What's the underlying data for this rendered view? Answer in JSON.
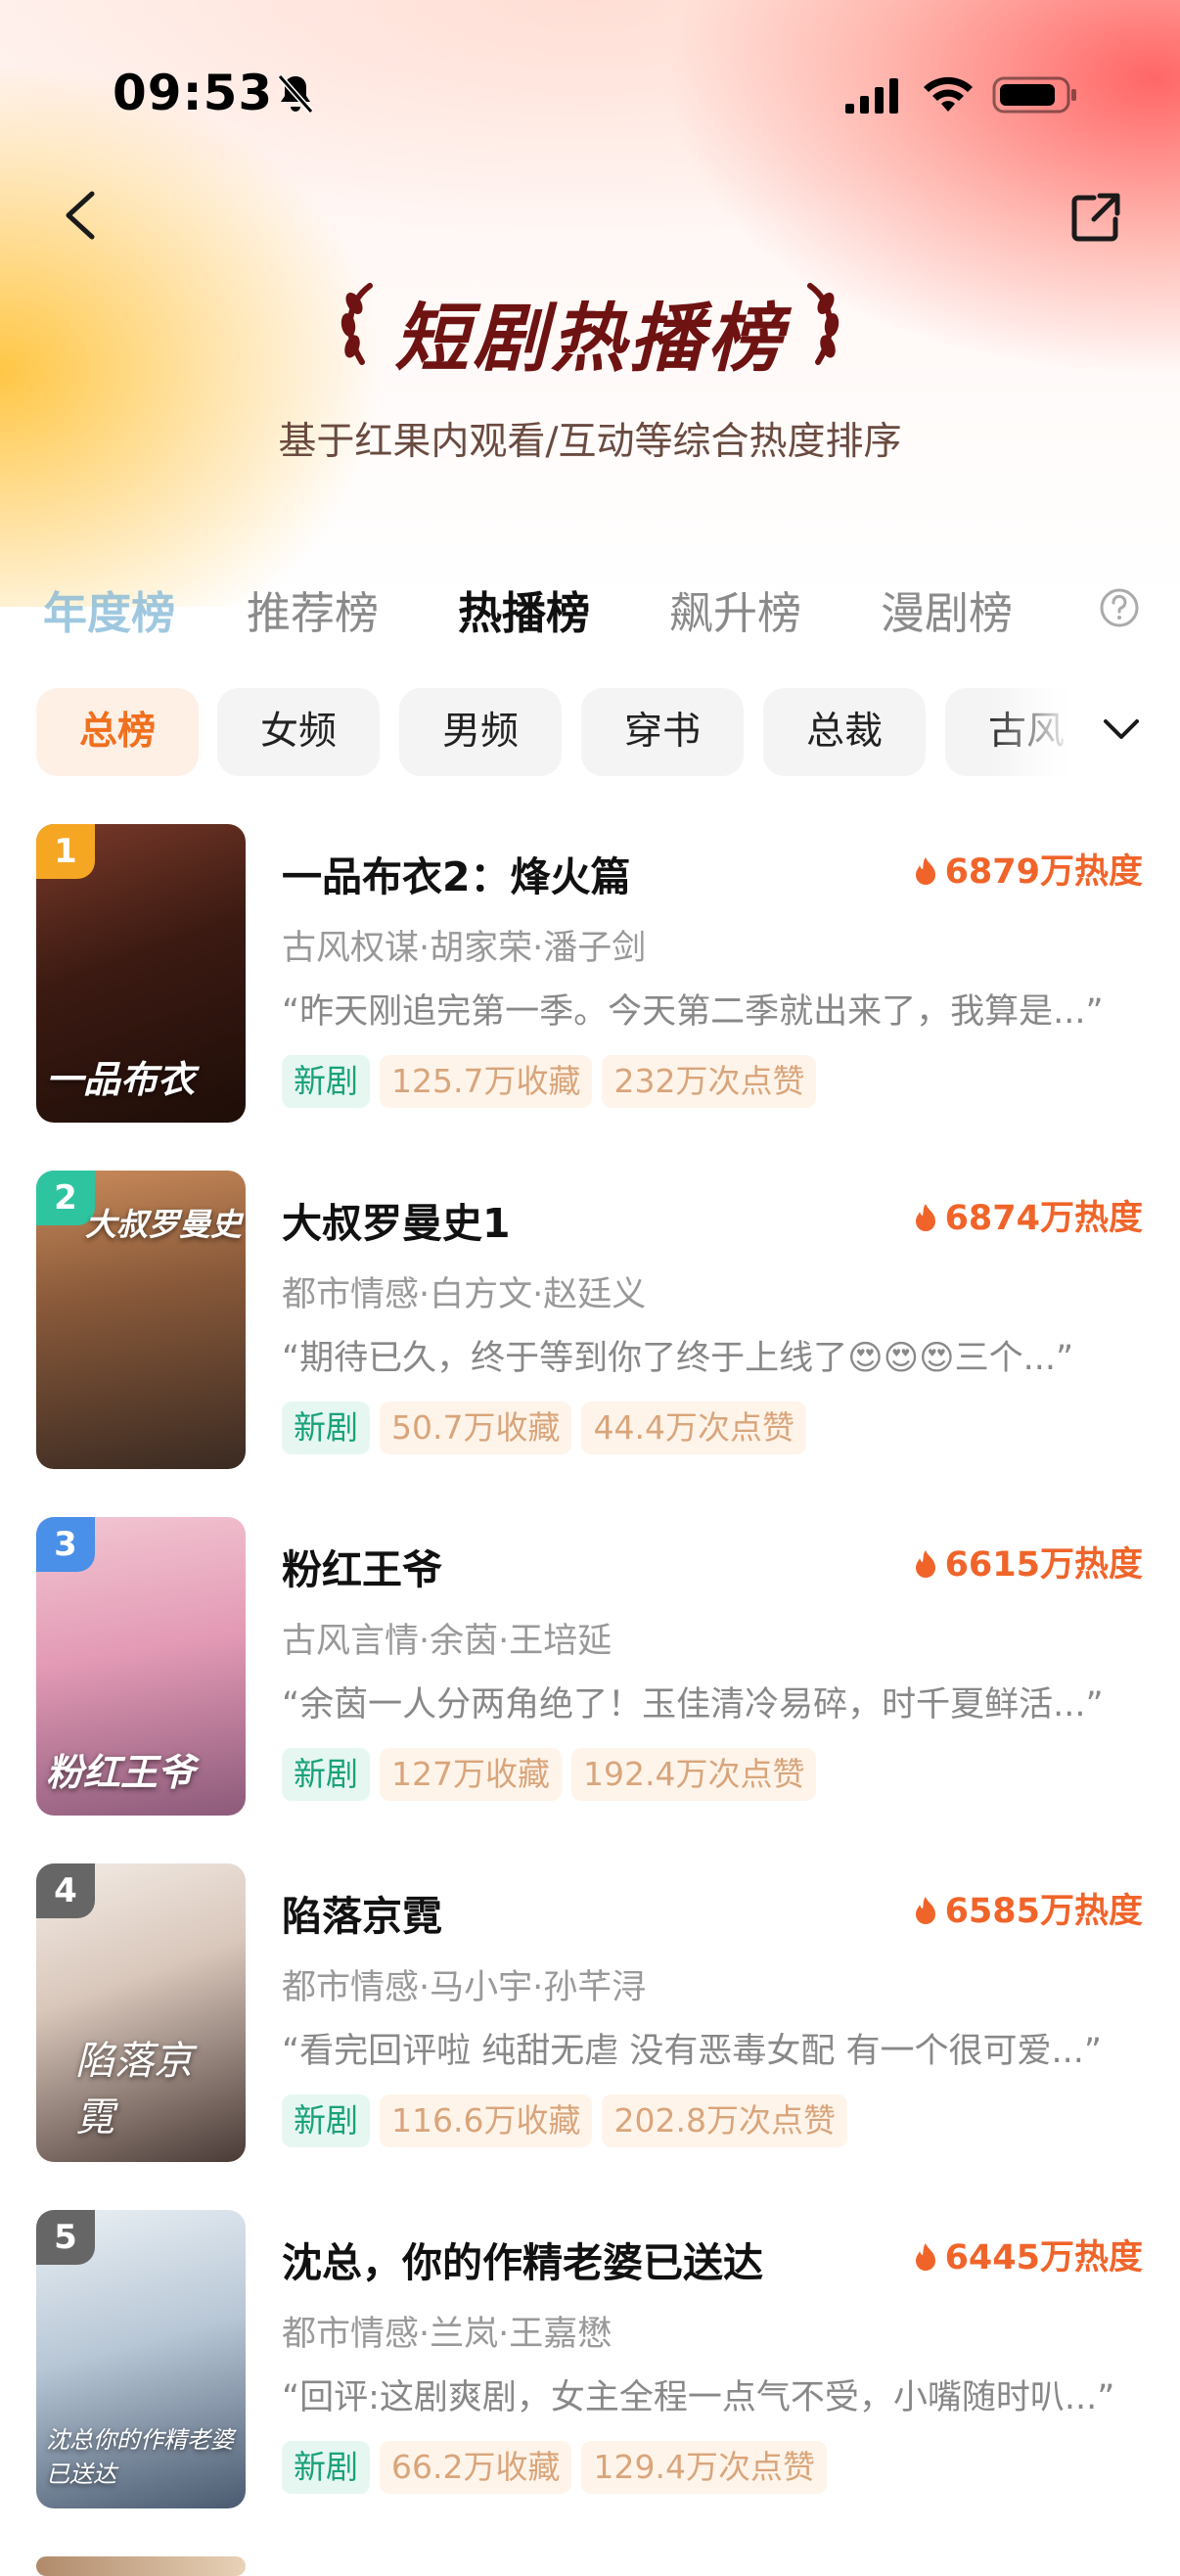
{
  "status_bar": {
    "time": "09:53"
  },
  "header": {
    "title": "短剧热播榜",
    "subtitle": "基于红果内观看/互动等综合热度排序"
  },
  "tabs": [
    {
      "label": "年度榜"
    },
    {
      "label": "推荐榜"
    },
    {
      "label": "热播榜"
    },
    {
      "label": "飙升榜"
    },
    {
      "label": "漫剧榜"
    }
  ],
  "filters": [
    {
      "label": "总榜"
    },
    {
      "label": "女频"
    },
    {
      "label": "男频"
    },
    {
      "label": "穿书"
    },
    {
      "label": "总裁"
    },
    {
      "label": "古风"
    }
  ],
  "items": [
    {
      "rank": "1",
      "title": "一品布衣2：烽火篇",
      "heat": "6879万热度",
      "meta": "古风权谋·胡家荣·潘子剑",
      "quote": "“昨天刚追完第一季。今天第二季就出来了，我算是...”",
      "tag_new": "新剧",
      "favorites": "125.7万收藏",
      "likes": "232万次点赞",
      "poster_text": "一品布衣",
      "badge_color": "#f5a623"
    },
    {
      "rank": "2",
      "title": "大叔罗曼史1",
      "heat": "6874万热度",
      "meta": "都市情感·白方文·赵廷义",
      "quote": "“期待已久，终于等到你了终于上线了😍😍😍三个...”",
      "tag_new": "新剧",
      "favorites": "50.7万收藏",
      "likes": "44.4万次点赞",
      "poster_text": "大叔罗曼史",
      "badge_color": "#2ec4a0"
    },
    {
      "rank": "3",
      "title": "粉红王爷",
      "heat": "6615万热度",
      "meta": "古风言情·余茵·王培延",
      "quote": "“余茵一人分两角绝了！玉佳清冷易碎，时千夏鲜活...”",
      "tag_new": "新剧",
      "favorites": "127万收藏",
      "likes": "192.4万次点赞",
      "poster_text": "粉红王爷",
      "badge_color": "#4a8fe8"
    },
    {
      "rank": "4",
      "title": "陷落京霓",
      "heat": "6585万热度",
      "meta": "都市情感·马小宇·孙芊浔",
      "quote": "“看完回评啦 纯甜无虐 没有恶毒女配 有一个很可爱...”",
      "tag_new": "新剧",
      "favorites": "116.6万收藏",
      "likes": "202.8万次点赞",
      "poster_text": "陷落京霓",
      "badge_color": "#666666"
    },
    {
      "rank": "5",
      "title": "沈总，你的作精老婆已送达",
      "heat": "6445万热度",
      "meta": "都市情感·兰岚·王嘉懋",
      "quote": "“回评:这剧爽剧，女主全程一点气不受，小嘴随时叭...”",
      "tag_new": "新剧",
      "favorites": "66.2万收藏",
      "likes": "129.4万次点赞",
      "poster_text": "沈总你的作精老婆已送达",
      "badge_color": "#666666"
    }
  ]
}
